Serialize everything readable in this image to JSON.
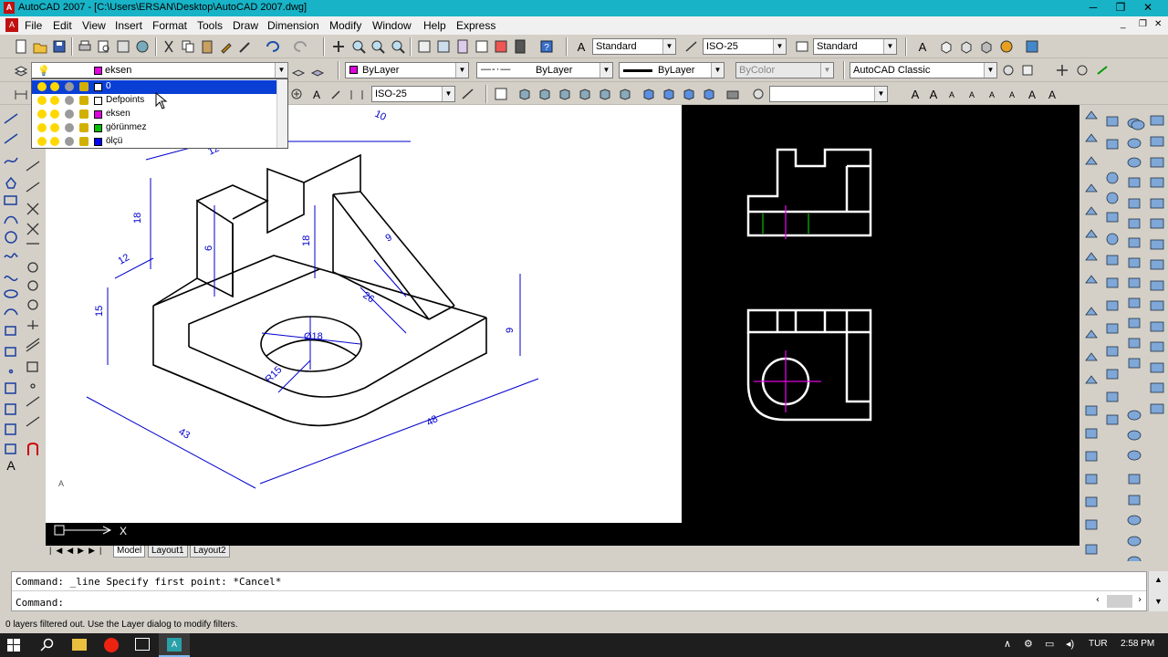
{
  "window": {
    "title": "AutoCAD 2007 - [C:\\Users\\ERSAN\\Desktop\\AutoCAD 2007.dwg]",
    "min": "─",
    "max": "❐",
    "close": "✕"
  },
  "menu": [
    "File",
    "Edit",
    "View",
    "Insert",
    "Format",
    "Tools",
    "Draw",
    "Dimension",
    "Modify",
    "Window",
    "Help",
    "Express"
  ],
  "toolbar": {
    "text_style": "Standard",
    "dim_style": "ISO-25",
    "table_style": "Standard",
    "layer": "eksen",
    "color": "ByLayer",
    "linetype": "ByLayer",
    "lineweight": "ByLayer",
    "plotstyle": "ByColor",
    "workspace": "AutoCAD Classic",
    "dim_style2": "ISO-25"
  },
  "layers": [
    {
      "name": "0",
      "color": "#ffffff",
      "selected": true
    },
    {
      "name": "Defpoints",
      "color": "#ffffff",
      "selected": false
    },
    {
      "name": "eksen",
      "color": "#e000e0",
      "selected": false
    },
    {
      "name": "görünmez",
      "color": "#00c000",
      "selected": false
    },
    {
      "name": "ölçü",
      "color": "#0000ff",
      "selected": false
    }
  ],
  "drawing": {
    "dims": [
      "10",
      "12",
      "18",
      "6",
      "18",
      "9",
      "12",
      "15",
      "26",
      "Ø18",
      "R15",
      "9",
      "43",
      "48"
    ]
  },
  "tabs": {
    "model": "Model",
    "layout1": "Layout1",
    "layout2": "Layout2"
  },
  "command": {
    "line1": "Command: _line Specify first point: *Cancel*",
    "line2": "Command:"
  },
  "status": {
    "message": "0 layers filtered out.  Use the Layer dialog to modify filters."
  },
  "taskbar": {
    "lang": "TUR",
    "time": "2:58 PM"
  }
}
